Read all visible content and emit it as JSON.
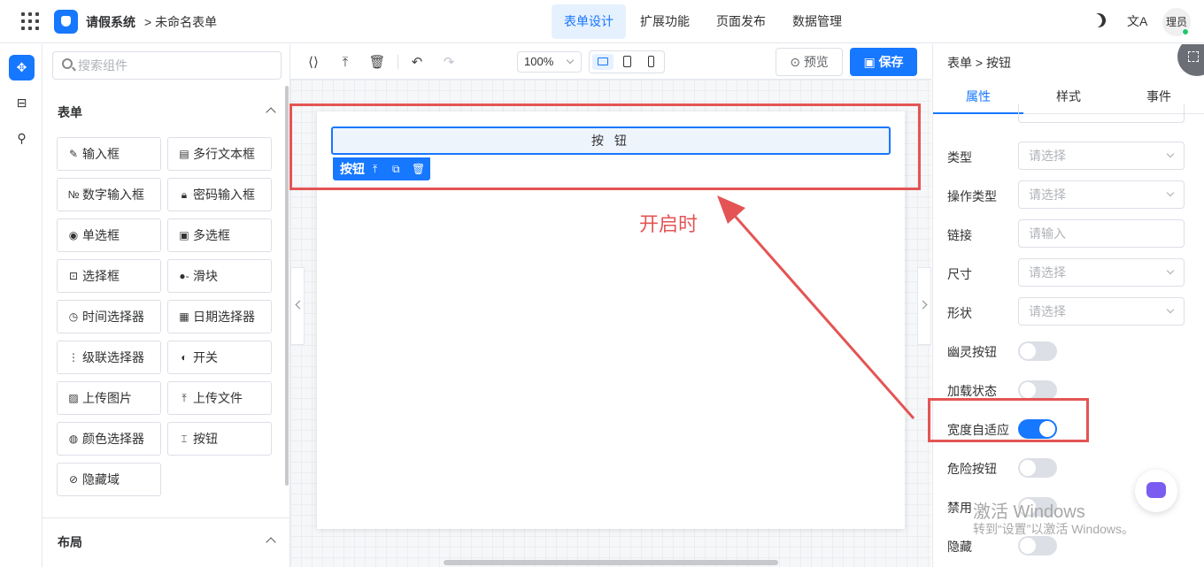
{
  "header": {
    "app_title": "请假系统",
    "breadcrumb": "> 未命名表单",
    "tabs": [
      "表单设计",
      "扩展功能",
      "页面发布",
      "数据管理"
    ],
    "active_tab": "表单设计",
    "lang_glyph": "文A",
    "avatar_text": "理员"
  },
  "left_strip": {
    "items": [
      "components-icon",
      "form-icon",
      "tree-icon"
    ]
  },
  "components": {
    "search_placeholder": "搜索组件",
    "group_form": "表单",
    "items": [
      {
        "label": "输入框",
        "icon": "edit-icon",
        "glyph": "✎"
      },
      {
        "label": "多行文本框",
        "icon": "textarea-icon",
        "glyph": "▤"
      },
      {
        "label": "数字输入框",
        "icon": "number-icon",
        "glyph": "№"
      },
      {
        "label": "密码输入框",
        "icon": "lock-icon",
        "glyph": "🔒︎"
      },
      {
        "label": "单选框",
        "icon": "radio-icon",
        "glyph": "◉"
      },
      {
        "label": "多选框",
        "icon": "checkbox-icon",
        "glyph": "▣"
      },
      {
        "label": "选择框",
        "icon": "select-icon",
        "glyph": "⊡"
      },
      {
        "label": "滑块",
        "icon": "slider-icon",
        "glyph": "●-"
      },
      {
        "label": "时间选择器",
        "icon": "clock-icon",
        "glyph": "◷"
      },
      {
        "label": "日期选择器",
        "icon": "calendar-icon",
        "glyph": "▦"
      },
      {
        "label": "级联选择器",
        "icon": "cascader-icon",
        "glyph": "⋮"
      },
      {
        "label": "开关",
        "icon": "switch-icon",
        "glyph": "◐"
      },
      {
        "label": "上传图片",
        "icon": "image-icon",
        "glyph": "▨"
      },
      {
        "label": "上传文件",
        "icon": "upload-icon",
        "glyph": "⤒"
      },
      {
        "label": "颜色选择器",
        "icon": "palette-icon",
        "glyph": "◍"
      },
      {
        "label": "按钮",
        "icon": "button-icon",
        "glyph": "⌶"
      },
      {
        "label": "隐藏域",
        "icon": "eye-off-icon",
        "glyph": "⊘"
      }
    ],
    "group_layout": "布局"
  },
  "toolbar": {
    "zoom": "100%",
    "preview_label": "预览",
    "save_label": "保存",
    "active_device": "desktop"
  },
  "canvas": {
    "button_text": "按 钮",
    "selected_label": "按钮",
    "annotation": "开启时"
  },
  "props": {
    "breadcrumb": "表单 > 按钮",
    "tabs": [
      "属性",
      "样式",
      "事件"
    ],
    "active_tab": "属性",
    "fields": [
      {
        "label": "类型",
        "kind": "select",
        "placeholder": "请选择"
      },
      {
        "label": "操作类型",
        "kind": "select",
        "placeholder": "请选择"
      },
      {
        "label": "链接",
        "kind": "input",
        "placeholder": "请输入"
      },
      {
        "label": "尺寸",
        "kind": "select",
        "placeholder": "请选择"
      },
      {
        "label": "形状",
        "kind": "select",
        "placeholder": "请选择"
      },
      {
        "label": "幽灵按钮",
        "kind": "switch",
        "on": false
      },
      {
        "label": "加载状态",
        "kind": "switch",
        "on": false
      },
      {
        "label": "宽度自适应",
        "kind": "switch",
        "on": true
      },
      {
        "label": "危险按钮",
        "kind": "switch",
        "on": false
      },
      {
        "label": "禁用",
        "kind": "switch",
        "on": false
      },
      {
        "label": "隐藏",
        "kind": "switch",
        "on": false
      }
    ]
  },
  "watermark": {
    "line1": "激活 Windows",
    "line2": "转到“设置”以激活 Windows。"
  },
  "colors": {
    "accent": "#1677ff",
    "annotation": "#e45454"
  }
}
